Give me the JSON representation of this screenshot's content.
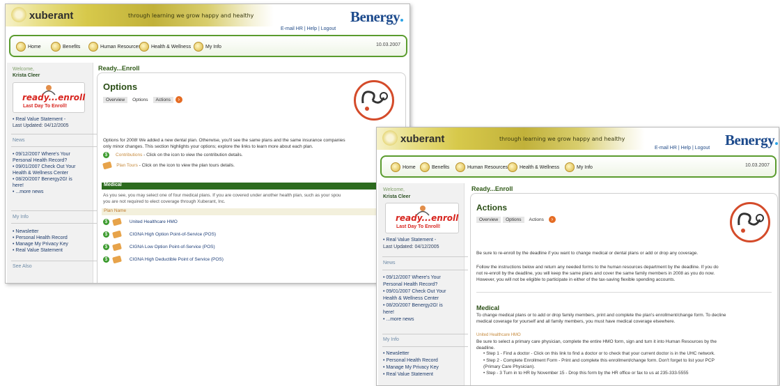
{
  "brand": {
    "logo": "xuberant",
    "tagline": "through learning we grow happy and healthy",
    "company": "Benergy"
  },
  "top_links": {
    "email": "E-mail HR",
    "help": "Help",
    "logout": "Logout",
    "sep": "|"
  },
  "nav": {
    "home": "Home",
    "benefits": "Benefits",
    "hr": "Human Resources",
    "wellness": "Health & Wellness",
    "myinfo": "My Info",
    "date": "10.03.2007"
  },
  "sidebar": {
    "welcome": "Welcome,",
    "user": "Krista Cleer",
    "promo_top": "ready...enroll",
    "promo_bottom": "Last Day To Enroll!",
    "statement": "• Real Value Statement -",
    "updated": "Last Updated: 04/12/2005",
    "news_head": "News",
    "news1": "• 09/12/2007 Where's Your",
    "news1b": "Personal Health Record?",
    "news2": "• 09/01/2007 Check Out Your",
    "news2b": "Health & Wellness Center",
    "news3": "• 08/20/2007 Benergy2G! is",
    "news3b": "here!",
    "more": "• ...more news",
    "myinfo_head": "My Info",
    "info1": "• Newsletter",
    "info2": "• Personal Health Record",
    "info3": "• Manage My Privacy Key",
    "info4": "• Real Value Statement",
    "seealso": "See Also"
  },
  "section": {
    "title": "Ready...Enroll"
  },
  "tabs": {
    "overview": "Overview",
    "options": "Options",
    "actions": "Actions",
    "arrow": "›"
  },
  "options_page": {
    "heading": "Options",
    "intro1": "Options for 2008! We added a new dental plan. Otherwise, you'll see the same plans and the same insurance companies",
    "intro2": "only minor changes. This section highlights your options; explore the links to learn more about each plan.",
    "contrib_link": "Contributions",
    "contrib_text": " - Click on the icon to view the contribution details.",
    "tours_link": "Plan Tours",
    "tours_text": " - Click on the icon to view the plan tours details.",
    "medical_bar": "Medical",
    "medical1": "As you see, you may select one of four medical plans. If you are covered under another health plan, such as your spou",
    "medical2": "you are not required to elect coverage through Xuberant, Inc.",
    "plan_header": "Plan Name",
    "plans": [
      "United Healthcare HMO",
      "CIGNA High Option Point-of-Service (POS)",
      "CIGNA Low Option Point-of-Service (POS)",
      "CIGNA High Deductible Point of Service (POS)"
    ]
  },
  "actions_page": {
    "heading": "Actions",
    "p1": "Be sure to re-enroll by the deadline if you want to change medical or dental plans or add or drop any coverage.",
    "p2a": "Follow the instructions below and return any needed forms to the human resources department by the deadline. If you do",
    "p2b": "not re-enroll by the deadline, you will keep the same plans and cover the same family members in 2008 as you do now.",
    "p2c": "However, you will not be eligible to participate in either of the tax-saving flexible spending accounts.",
    "medical_head": "Medical",
    "m1": "To change medical plans or to add or drop family members, print and complete the plan's enrollment/change form. To decline",
    "m2": "medical coverage for yourself and all family members, you must have medical coverage elsewhere.",
    "plan_link": "United Healthcare HMO",
    "pl1": "Be sure to select a primary care physician, complete the entire HMO form, sign and turn it into Human Resources by the",
    "pl2": "deadline.",
    "s1": "• Step 1 - Find a doctor - Click on this link to find a doctor or to check that your current doctor is in the UHC network.",
    "s2a": "• Step 2 - Complete Enrollment Form - Print and complete this enrollment/change form. Don't forget to list your PCP",
    "s2b": "(Primary Care Physician).",
    "s3": "• Step - 3 Turn in to HR by November 15 - Drop this form by the HR office or fax to us at 235-333-5555"
  }
}
